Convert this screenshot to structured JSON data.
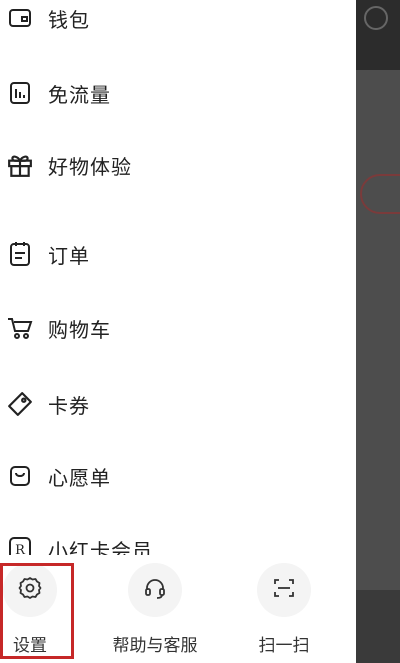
{
  "menu": {
    "items": [
      {
        "label": "钱包",
        "icon": "wallet-icon"
      },
      {
        "label": "免流量",
        "icon": "data-plan-icon"
      },
      {
        "label": "好物体验",
        "icon": "gift-icon"
      },
      {
        "label": "订单",
        "icon": "order-icon"
      },
      {
        "label": "购物车",
        "icon": "cart-icon"
      },
      {
        "label": "卡券",
        "icon": "coupon-icon"
      },
      {
        "label": "心愿单",
        "icon": "wishlist-icon"
      },
      {
        "label": "小红卡会员",
        "icon": "red-card-icon"
      }
    ]
  },
  "bottom_bar": {
    "settings_label": "设置",
    "help_label": "帮助与客服",
    "scan_label": "扫一扫"
  },
  "colors": {
    "highlight": "#c62828",
    "text": "#222222",
    "circle_bg": "#f4f4f4"
  }
}
